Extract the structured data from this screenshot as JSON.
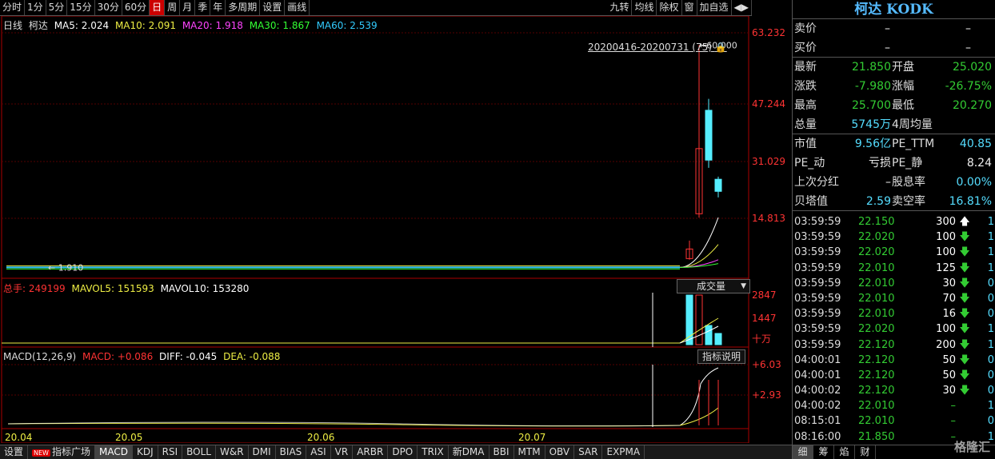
{
  "toolbar": {
    "periods": [
      "分时",
      "1分",
      "5分",
      "15分",
      "30分",
      "60分",
      "日",
      "周",
      "月",
      "季",
      "年",
      "多周期",
      "设置",
      "画线"
    ],
    "active_period": "日",
    "right_buttons": [
      "九转",
      "均线",
      "除权",
      "窗",
      "加自选",
      "◀▶"
    ]
  },
  "main_legend": {
    "title": "日线",
    "name": "柯达",
    "ma5": "MA5: 2.024",
    "ma10": "MA10: 2.091",
    "ma20": "MA20: 1.918",
    "ma30": "MA30: 1.867",
    "ma60": "MA60: 2.539"
  },
  "range_label": "20200416-20200731 (75)",
  "high_marker": "60.000",
  "low_marker": "1.910",
  "price_axis": [
    "63.232",
    "47.244",
    "31.029",
    "14.813"
  ],
  "vol_legend": {
    "total": "总手: 249199",
    "mavol5": "MAVOL5: 151593",
    "mavol10": "MAVOL10: 153280"
  },
  "vol_dropdown": "成交量",
  "vol_axis": [
    "2847",
    "1447",
    "十万"
  ],
  "macd_legend": {
    "params": "MACD(12,26,9)",
    "macd": "MACD: +0.086",
    "diff": "DIFF: -0.045",
    "dea": "DEA: -0.088"
  },
  "macd_help": "指标说明",
  "macd_axis": [
    "+6.03",
    "+2.93"
  ],
  "date_axis": [
    "20.04",
    "20.05",
    "20.06",
    "20.07"
  ],
  "bottom_tabs": [
    "设置",
    "指标广场",
    "MACD",
    "KDJ",
    "RSI",
    "BOLL",
    "W&R",
    "DMI",
    "BIAS",
    "ASI",
    "VR",
    "ARBR",
    "DPO",
    "TRIX",
    "新DMA",
    "BBI",
    "MTM",
    "OBV",
    "SAR",
    "EXPMA"
  ],
  "new_badge": "NEW",
  "active_bottom_tab": "MACD",
  "quote": {
    "title": "柯达 KODK",
    "sell_label": "卖价",
    "sell_value": "–",
    "buy_label": "买价",
    "buy_value": "–",
    "rows": [
      {
        "l": "最新",
        "v1": "21.850",
        "c1": "green",
        "l2": "开盘",
        "v2": "25.020",
        "c2": "green"
      },
      {
        "l": "涨跌",
        "v1": "-7.980",
        "c1": "green",
        "l2": "涨幅",
        "v2": "-26.75%",
        "c2": "green"
      },
      {
        "l": "最高",
        "v1": "25.700",
        "c1": "green",
        "l2": "最低",
        "v2": "20.270",
        "c2": "green"
      },
      {
        "l": "总量",
        "v1": "5745万",
        "c1": "cyan",
        "l2": "4周均量",
        "v2": "",
        "c2": "white"
      },
      {
        "l": "市值",
        "v1": "9.56亿",
        "c1": "cyan",
        "l2": "PE_TTM",
        "v2": "40.85",
        "c2": "cyan"
      },
      {
        "l": "PE_动",
        "v1": "亏损",
        "c1": "white",
        "l2": "PE_静",
        "v2": "8.24",
        "c2": "white"
      },
      {
        "l": "上次分红",
        "v1": "–",
        "c1": "white",
        "l2": "股息率",
        "v2": "0.00%",
        "c2": "cyan"
      },
      {
        "l": "贝塔值",
        "v1": "2.59",
        "c1": "cyan",
        "l2": "卖空率",
        "v2": "16.81%",
        "c2": "cyan"
      }
    ]
  },
  "ticks": [
    {
      "t": "03:59:59",
      "p": "22.150",
      "q": "300",
      "d": "up",
      "n": "1"
    },
    {
      "t": "03:59:59",
      "p": "22.020",
      "q": "100",
      "d": "down",
      "n": "1"
    },
    {
      "t": "03:59:59",
      "p": "22.020",
      "q": "100",
      "d": "down",
      "n": "1"
    },
    {
      "t": "03:59:59",
      "p": "22.010",
      "q": "125",
      "d": "down",
      "n": "1"
    },
    {
      "t": "03:59:59",
      "p": "22.010",
      "q": "30",
      "d": "down",
      "n": "0"
    },
    {
      "t": "03:59:59",
      "p": "22.010",
      "q": "70",
      "d": "down",
      "n": "0"
    },
    {
      "t": "03:59:59",
      "p": "22.010",
      "q": "16",
      "d": "down",
      "n": "0"
    },
    {
      "t": "03:59:59",
      "p": "22.020",
      "q": "100",
      "d": "down",
      "n": "1"
    },
    {
      "t": "03:59:59",
      "p": "22.120",
      "q": "200",
      "d": "down",
      "n": "1"
    },
    {
      "t": "04:00:01",
      "p": "22.120",
      "q": "50",
      "d": "down",
      "n": "0"
    },
    {
      "t": "04:00:01",
      "p": "22.120",
      "q": "50",
      "d": "down",
      "n": "0"
    },
    {
      "t": "04:00:02",
      "p": "22.120",
      "q": "30",
      "d": "down",
      "n": "0"
    },
    {
      "t": "04:00:02",
      "p": "22.010",
      "q": "–",
      "d": "none",
      "n": "1"
    },
    {
      "t": "08:15:01",
      "p": "22.010",
      "q": "–",
      "d": "none",
      "n": "0"
    },
    {
      "t": "08:16:00",
      "p": "21.850",
      "q": "–",
      "d": "none",
      "n": "1"
    }
  ],
  "panel_tabs": [
    "细",
    "筹",
    "焰",
    "财"
  ],
  "watermark": "格隆汇",
  "colors": {
    "up": "#ff3333",
    "down": "#55eeff",
    "ma5": "#ffffff",
    "ma10": "#ffff44",
    "ma20": "#ff44ff",
    "ma30": "#33ff33",
    "ma60": "#33ccff"
  },
  "chart_data": {
    "type": "candlestick",
    "last_candles": [
      {
        "open": 2.0,
        "close": 2.1,
        "high": 2.3,
        "low": 1.95
      },
      {
        "open": 4.3,
        "close": 6.8,
        "high": 9.0,
        "low": 4.0
      },
      {
        "open": 16.0,
        "close": 33.0,
        "high": 60.0,
        "low": 15.0
      },
      {
        "open": 43.0,
        "close": 30.0,
        "high": 46.0,
        "low": 28.0
      },
      {
        "open": 25.0,
        "close": 21.85,
        "high": 25.7,
        "low": 20.27
      }
    ],
    "volume_last": [
      2847,
      2847,
      1447,
      1000
    ]
  }
}
